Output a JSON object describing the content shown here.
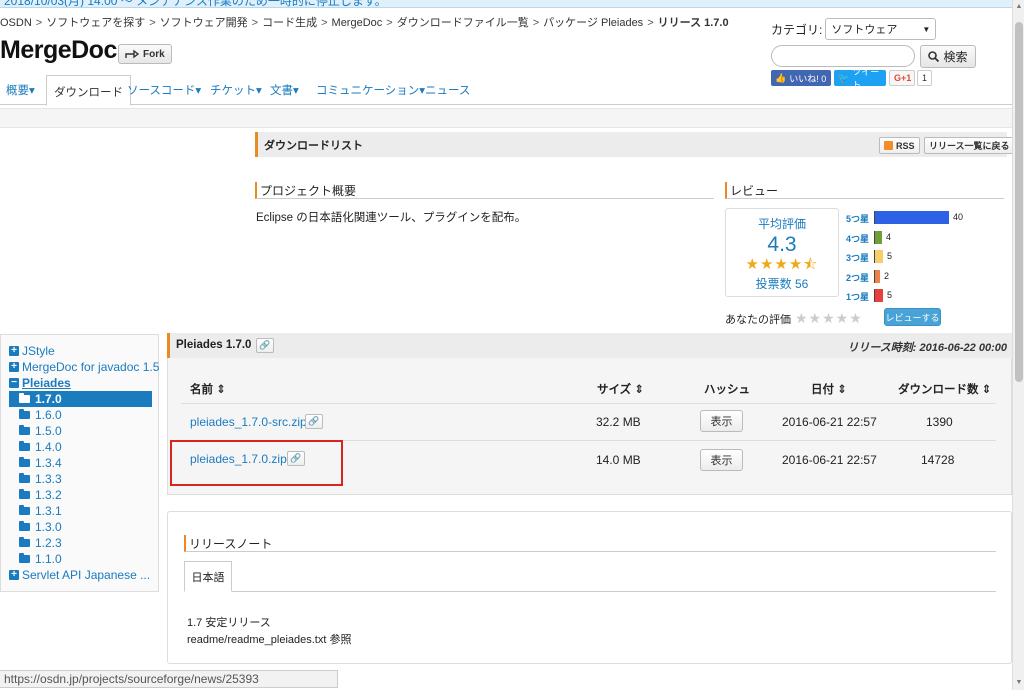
{
  "banner": {
    "text": "2018/10/03(月) 14:00 〜 メンテナンス作業のため一時的に停止します。"
  },
  "breadcrumb": {
    "items": [
      "OSDN",
      "ソフトウェアを探す",
      "ソフトウェア開発",
      "コード生成",
      "MergeDoc",
      "ダウンロードファイル一覧",
      "パッケージ Pleiades"
    ],
    "current": "リリース 1.7.0",
    "separator": ">"
  },
  "project": {
    "title": "MergeDoc",
    "fork_label": "Fork"
  },
  "category": {
    "label": "カテゴリ:",
    "selected": "ソフトウェア"
  },
  "search": {
    "placeholder": "",
    "button_label": "検索"
  },
  "social": {
    "like_label": "いいね! 0",
    "tweet_label": "ツイート",
    "gplus_label": "G+1",
    "gplus_count": "1"
  },
  "tabs": [
    {
      "label": "概要▾"
    },
    {
      "label": "ダウンロード"
    },
    {
      "label": "ソースコード▾"
    },
    {
      "label": "チケット▾"
    },
    {
      "label": "文書▾"
    },
    {
      "label": "コミュニケーション▾"
    },
    {
      "label": "ニュース"
    }
  ],
  "download_list": {
    "title": "ダウンロードリスト",
    "rss_label": "RSS",
    "back_label": "リリース一覧に戻る"
  },
  "overview": {
    "title": "プロジェクト概要",
    "text": "Eclipse の日本語化関連ツール、プラグインを配布。"
  },
  "review": {
    "title": "レビュー",
    "avg_label": "平均評価",
    "score": "4.3",
    "stars_display": "★★★★⯪",
    "votes_label": "投票数 56",
    "your_rating_label": "あなたの評価",
    "your_stars": "★★★★★",
    "review_button": "レビューする"
  },
  "chart_data": {
    "type": "bar",
    "categories": [
      "5つ星",
      "4つ星",
      "3つ星",
      "2つ星",
      "1つ星"
    ],
    "values": [
      40,
      4,
      5,
      2,
      5
    ],
    "colors": [
      "#2e62e6",
      "#6f9f36",
      "#f6cf6a",
      "#ee7f45",
      "#e8403a"
    ]
  },
  "sidebar": {
    "items": [
      {
        "type": "pkg",
        "label": "JStyle"
      },
      {
        "type": "pkg",
        "label": "MergeDoc for javadoc 1.5"
      },
      {
        "type": "pkg-open",
        "label": "Pleiades"
      },
      {
        "type": "release",
        "label": "1.7.0",
        "selected": true
      },
      {
        "type": "release",
        "label": "1.6.0"
      },
      {
        "type": "release",
        "label": "1.5.0"
      },
      {
        "type": "release",
        "label": "1.4.0"
      },
      {
        "type": "release",
        "label": "1.3.4"
      },
      {
        "type": "release",
        "label": "1.3.3"
      },
      {
        "type": "release",
        "label": "1.3.2"
      },
      {
        "type": "release",
        "label": "1.3.1"
      },
      {
        "type": "release",
        "label": "1.3.0"
      },
      {
        "type": "release",
        "label": "1.2.3"
      },
      {
        "type": "release",
        "label": "1.1.0"
      },
      {
        "type": "pkg",
        "label": "Servlet API Japanese ..."
      }
    ],
    "icon_plus": "+",
    "icon_minus": "−"
  },
  "release": {
    "title": "Pleiades 1.7.0",
    "date_label": "リリース時刻: 2016-06-22 00:00",
    "columns": [
      "名前 ⇕",
      "サイズ ⇕",
      "ハッシュ",
      "日付 ⇕",
      "ダウンロード数 ⇕"
    ],
    "files": [
      {
        "name": "pleiades_1.7.0-src.zip",
        "size": "32.2 MB",
        "hash_label": "表示",
        "date": "2016-06-21 22:57",
        "downloads": "1390"
      },
      {
        "name": "pleiades_1.7.0.zip",
        "size": "14.0 MB",
        "hash_label": "表示",
        "date": "2016-06-21 22:57",
        "downloads": "14728"
      }
    ]
  },
  "notes": {
    "title": "リリースノート",
    "tab_label": "日本語",
    "line1": "1.7 安定リリース",
    "line2": "readme/readme_pleiades.txt 参照"
  },
  "status_url": "https://osdn.jp/projects/sourceforge/news/25393"
}
